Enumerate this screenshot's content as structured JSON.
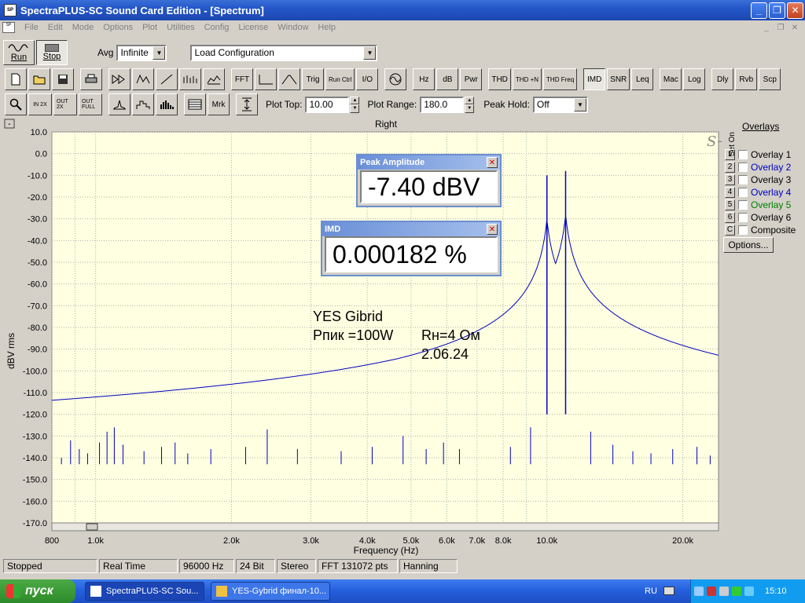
{
  "window": {
    "title": "SpectraPLUS-SC Sound Card Edition - [Spectrum]",
    "minimize": "_",
    "restore": "❐",
    "close": "✕"
  },
  "menu": [
    "File",
    "Edit",
    "Mode",
    "Options",
    "Plot",
    "Utilities",
    "Config",
    "License",
    "Window",
    "Help"
  ],
  "toolbar1": {
    "run": "Run",
    "stop": "Stop",
    "avg_label": "Avg",
    "avg_value": "Infinite",
    "config_value": "Load Configuration"
  },
  "toolbar2": {
    "buttons": [
      "FFT",
      "Trig",
      "Run Ctrl",
      "I/O",
      "Hz",
      "dB",
      "Pwr",
      "THD",
      "THD +N",
      "THD Freq",
      "IMD",
      "SNR",
      "Leq",
      "Mac",
      "Log",
      "Dly",
      "Rvb",
      "Scp"
    ]
  },
  "toolbar3": {
    "zoom_buttons": [
      "IN 2X",
      "OUT 2X",
      "OUT FULL"
    ],
    "mrk": "Mrk",
    "plot_top_label": "Plot Top:",
    "plot_top_value": "10.00",
    "plot_range_label": "Plot Range:",
    "plot_range_value": "180.0",
    "peak_hold_label": "Peak Hold:",
    "peak_hold_value": "Off"
  },
  "plot": {
    "channel": "Right",
    "watermark": "S+",
    "minus_box": "-",
    "plus_box": "+"
  },
  "chart_data": {
    "type": "line",
    "title": "Right",
    "xlabel": "Frequency (Hz)",
    "ylabel": "dBV rms",
    "x_scale": "log",
    "xlim": [
      800,
      24000
    ],
    "ylim": [
      -170,
      10
    ],
    "grid": true,
    "x_ticks": [
      {
        "v": 800,
        "label": "800"
      },
      {
        "v": 1000,
        "label": "1.0k"
      },
      {
        "v": 2000,
        "label": "2.0k"
      },
      {
        "v": 3000,
        "label": "3.0k"
      },
      {
        "v": 4000,
        "label": "4.0k"
      },
      {
        "v": 5000,
        "label": "5.0k"
      },
      {
        "v": 6000,
        "label": "6.0k"
      },
      {
        "v": 7000,
        "label": "7.0k"
      },
      {
        "v": 8000,
        "label": "8.0k"
      },
      {
        "v": 10000,
        "label": "10.0k"
      },
      {
        "v": 20000,
        "label": "20.0k"
      }
    ],
    "y_ticks": [
      10,
      0,
      -10,
      -20,
      -30,
      -40,
      -50,
      -60,
      -70,
      -80,
      -90,
      -100,
      -110,
      -120,
      -130,
      -140,
      -150,
      -160,
      -170
    ],
    "y_tick_labels": [
      "10.0",
      "0.0",
      "-10.0",
      "-20.0",
      "-30.0",
      "-40.0",
      "-50.0",
      "-60.0",
      "-70.0",
      "-80.0",
      "-90.0",
      "-100.0",
      "-110.0",
      "-120.0",
      "-130.0",
      "-140.0",
      "-150.0",
      "-160.0",
      "-170.0"
    ],
    "noise_floor_dbv": -143,
    "peaks": [
      {
        "f": 10000,
        "dbv": -10
      },
      {
        "f": 11000,
        "dbv": -8
      }
    ],
    "spurs": [
      {
        "f": 840,
        "dbv": -140
      },
      {
        "f": 880,
        "dbv": -132
      },
      {
        "f": 920,
        "dbv": -136
      },
      {
        "f": 960,
        "dbv": -138
      },
      {
        "f": 1020,
        "dbv": -133
      },
      {
        "f": 1060,
        "dbv": -128
      },
      {
        "f": 1100,
        "dbv": -126
      },
      {
        "f": 1150,
        "dbv": -134
      },
      {
        "f": 1280,
        "dbv": -137
      },
      {
        "f": 1400,
        "dbv": -135
      },
      {
        "f": 1500,
        "dbv": -133
      },
      {
        "f": 1600,
        "dbv": -138
      },
      {
        "f": 1800,
        "dbv": -136
      },
      {
        "f": 2150,
        "dbv": -135
      },
      {
        "f": 2400,
        "dbv": -127
      },
      {
        "f": 2800,
        "dbv": -136
      },
      {
        "f": 3500,
        "dbv": -137
      },
      {
        "f": 4100,
        "dbv": -135
      },
      {
        "f": 4800,
        "dbv": -130
      },
      {
        "f": 5400,
        "dbv": -136
      },
      {
        "f": 5900,
        "dbv": -133
      },
      {
        "f": 6400,
        "dbv": -136
      },
      {
        "f": 8300,
        "dbv": -135
      },
      {
        "f": 9200,
        "dbv": -126
      },
      {
        "f": 12500,
        "dbv": -128
      },
      {
        "f": 14000,
        "dbv": -134
      },
      {
        "f": 15500,
        "dbv": -137
      },
      {
        "f": 17000,
        "dbv": -138
      },
      {
        "f": 19000,
        "dbv": -136
      },
      {
        "f": 21500,
        "dbv": -135
      },
      {
        "f": 23000,
        "dbv": -139
      }
    ]
  },
  "readouts": {
    "peak": {
      "title": "Peak Amplitude",
      "value": "-7.40 dBV"
    },
    "imd": {
      "title": "IMD",
      "value": "0.000182 %"
    }
  },
  "notes": {
    "line1": "YES Gibrid",
    "line2a": "Рпик =100W",
    "line2b": "Rн=4 Ом",
    "line3": "2.06.24"
  },
  "overlays": {
    "title": "Overlays",
    "set_on": "Set On",
    "items": [
      {
        "num": "1",
        "label": "Overlay 1",
        "color": "#000000"
      },
      {
        "num": "2",
        "label": "Overlay 2",
        "color": "#0000c0"
      },
      {
        "num": "3",
        "label": "Overlay 3",
        "color": "#000000"
      },
      {
        "num": "4",
        "label": "Overlay 4",
        "color": "#0000c0"
      },
      {
        "num": "5",
        "label": "Overlay 5",
        "color": "#008000"
      },
      {
        "num": "6",
        "label": "Overlay 6",
        "color": "#000000"
      },
      {
        "num": "C",
        "label": "Composite",
        "color": "#000000"
      }
    ],
    "options": "Options..."
  },
  "status": [
    "Stopped",
    "Real Time",
    "96000 Hz",
    "24 Bit",
    "Stereo",
    "FFT 131072 pts",
    "Hanning"
  ],
  "taskbar": {
    "start": "пуск",
    "tasks": [
      "SpectraPLUS-SC Sou...",
      "YES-Gybrid финал-10..."
    ],
    "lang": "RU",
    "clock": "15:10"
  },
  "colors": {
    "plot_bg": "#ffffe1",
    "trace": "#0000c0",
    "grid": "#b0b0b0"
  }
}
